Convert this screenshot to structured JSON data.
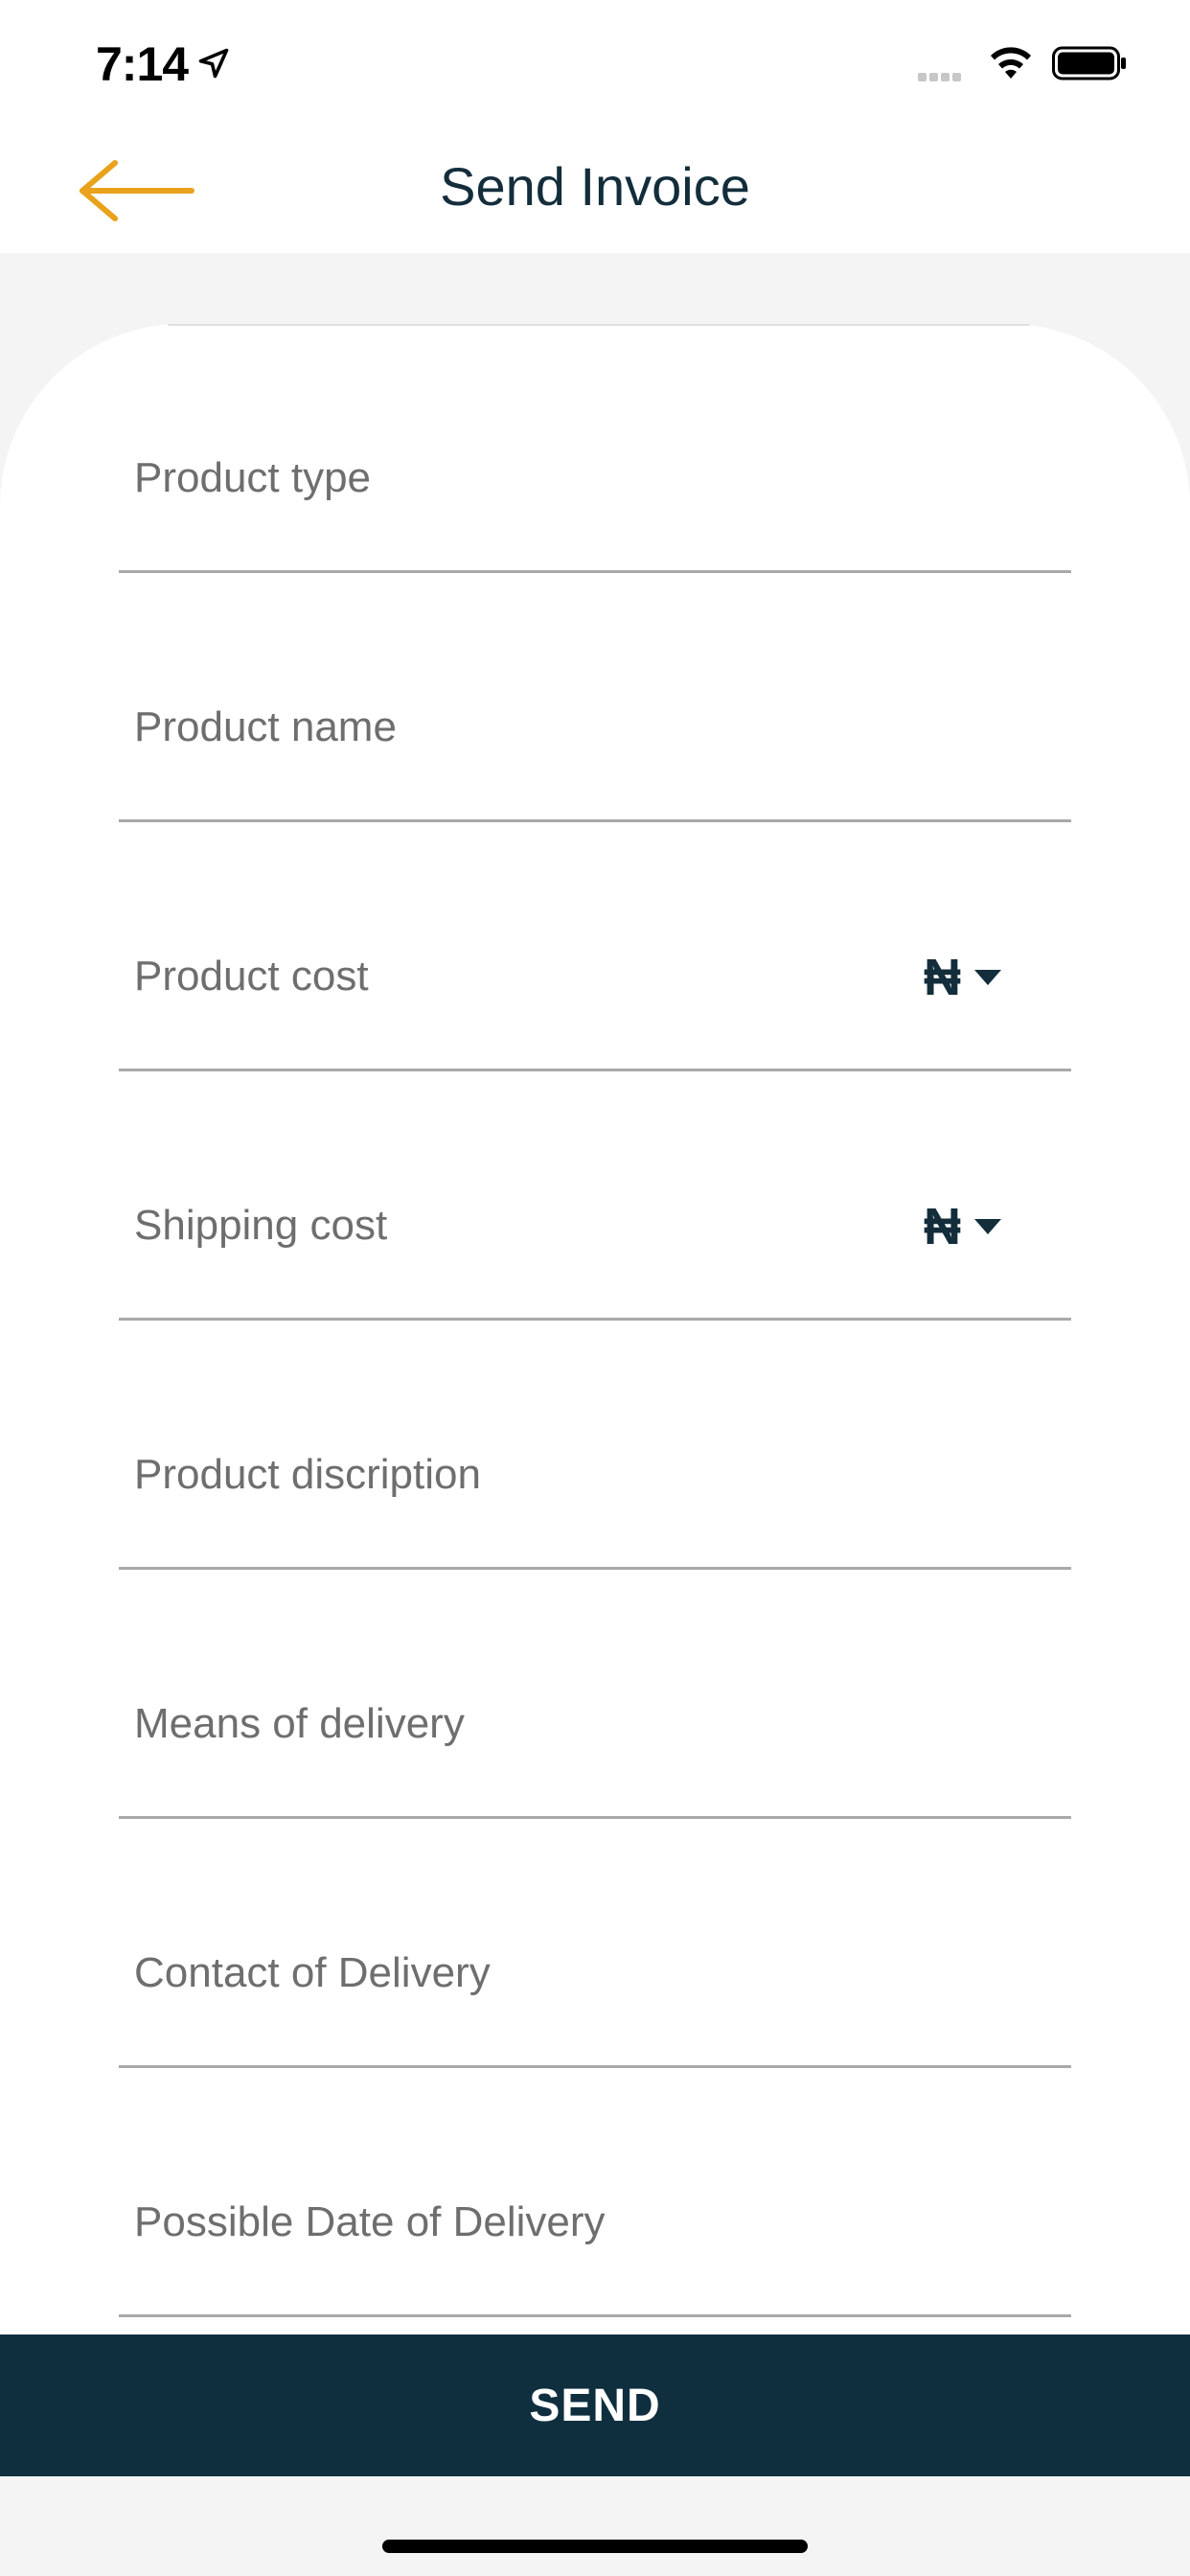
{
  "status_bar": {
    "time": "7:14"
  },
  "header": {
    "title": "Send Invoice"
  },
  "form": {
    "fields": [
      {
        "label": "Product type"
      },
      {
        "label": "Product name"
      },
      {
        "label": "Product cost",
        "currency": "₦"
      },
      {
        "label": "Shipping cost",
        "currency": "₦"
      },
      {
        "label": "Product discription"
      },
      {
        "label": "Means of delivery"
      },
      {
        "label": "Contact of Delivery"
      },
      {
        "label": "Possible Date of Delivery"
      }
    ]
  },
  "actions": {
    "send_label": "SEND"
  },
  "colors": {
    "accent": "#e8a21c",
    "primary_dark": "#0f2f3f",
    "background": "#f3f4f3"
  },
  "icons": {
    "back": "arrow-left-icon",
    "location": "location-arrow-icon",
    "wifi": "wifi-icon",
    "battery": "battery-icon",
    "caret": "caret-down-icon"
  }
}
